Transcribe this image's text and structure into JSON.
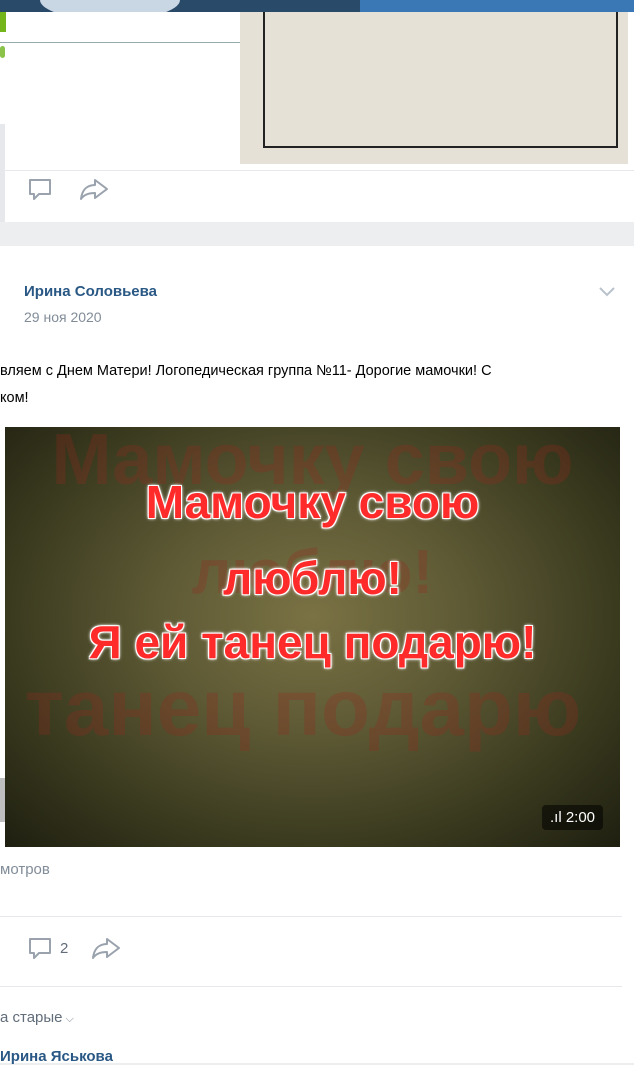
{
  "post1": {
    "actions": {
      "comment_icon": "comment-icon",
      "share_icon": "share-icon"
    }
  },
  "post2": {
    "author": "Ирина Соловьева",
    "date": "29 ноя 2020",
    "text": "вляем с Днем Матери! Логопедическая группа №11- Дорогие мамочки! С\nком!",
    "video": {
      "ghost_lines": [
        "Мамочку свою",
        "люблю!",
        "Й танец подарю"
      ],
      "lines": [
        "Мамочку свою",
        "люблю!",
        "Я  ей танец подарю!"
      ],
      "duration": ".ıl 2:00"
    },
    "views": "мотров",
    "comment_count": "2",
    "sort_label": "а старые",
    "commenter": "Ирина Яськова"
  },
  "colors": {
    "link": "#2a5885",
    "muted": "#818c99",
    "video_text": "#ff2a2a"
  }
}
